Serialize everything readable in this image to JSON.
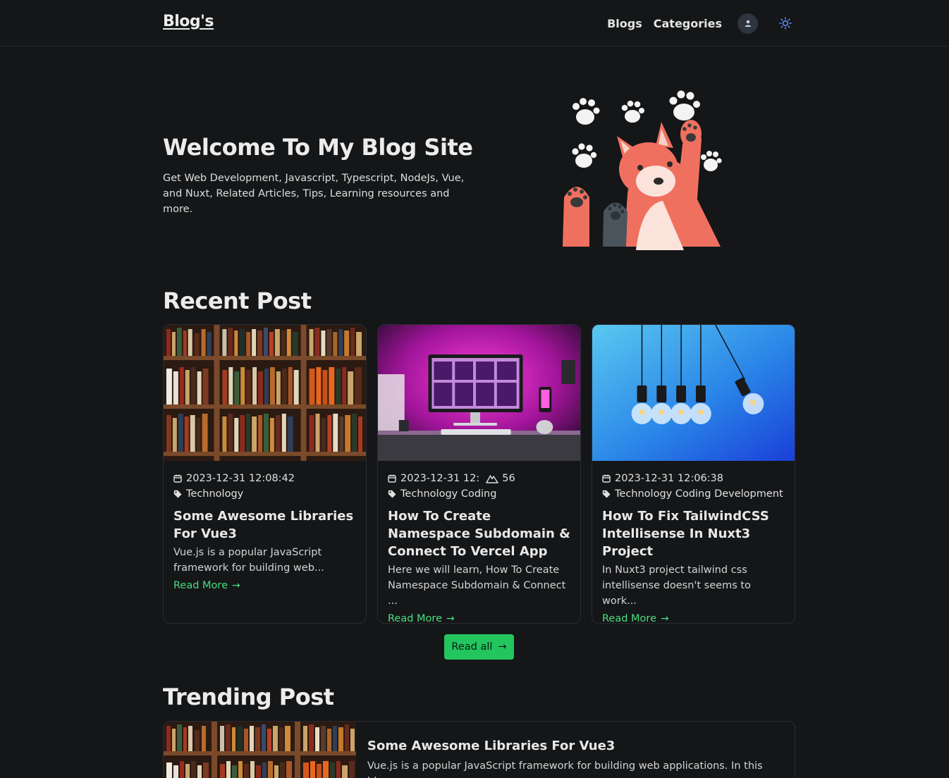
{
  "header": {
    "brand": "Blog's",
    "nav": [
      "Blogs",
      "Categories"
    ],
    "user_icon": "user-icon",
    "theme_icon": "sun-icon"
  },
  "hero": {
    "title": "Welcome To My Blog Site",
    "subtitle_line1": "Get Web Development, Javascript, Typescript, NodeJs, Vue,",
    "subtitle_line2": "and Nuxt, Related Articles, Tips, Learning resources and more."
  },
  "recent": {
    "title": "Recent Post",
    "posts": [
      {
        "date": "2023-12-31 12:08:42",
        "tags": "Technology",
        "title": "Some Awesome Libraries For Vue3",
        "desc": "Vue.js is a popular JavaScript framework for building web...",
        "read_more": "Read More"
      },
      {
        "date": "2023-12-31 12:",
        "date_tail": "56",
        "tags": "Technology Coding",
        "title": "How To Create Namespace Subdomain & Connect To Vercel App",
        "desc": "Here we will learn, How To Create Namespace Subdomain & Connect ...",
        "read_more": "Read More"
      },
      {
        "date": "2023-12-31 12:06:38",
        "tags": "Technology Coding Development",
        "title": "How To Fix TailwindCSS Intellisense In Nuxt3 Project",
        "desc": "In Nuxt3 project tailwind css intellisense doesn't seems to work...",
        "read_more": "Read More"
      }
    ],
    "read_all": "Read all"
  },
  "trending": {
    "title": "Trending Post",
    "post": {
      "title": "Some Awesome Libraries For Vue3",
      "desc": "Vue.js is a popular JavaScript framework for building web applications. In this blog"
    }
  },
  "colors": {
    "background": "#141618",
    "accent": "#22c55e",
    "link": "#4ade80"
  }
}
